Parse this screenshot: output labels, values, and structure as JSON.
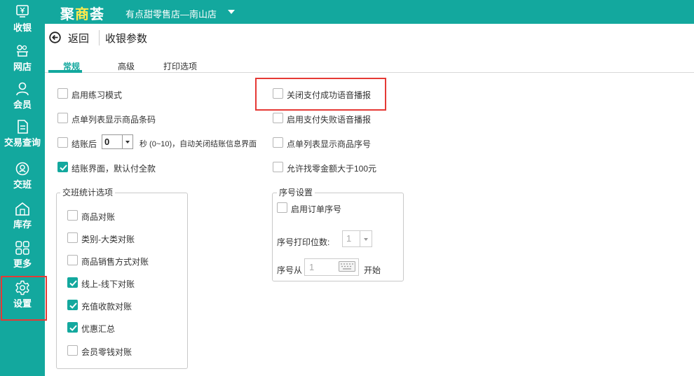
{
  "app": {
    "brand_part1": "聚",
    "brand_part2": "商",
    "brand_part3": "荟",
    "store_name": "有点甜零售店—南山店",
    "accent_color": "#13a89e",
    "highlight_color": "#e53935"
  },
  "sidebar": {
    "items": [
      {
        "label": "收银",
        "icon": "cashier-icon"
      },
      {
        "label": "网店",
        "icon": "online-store-icon"
      },
      {
        "label": "会员",
        "icon": "member-icon"
      },
      {
        "label": "交易查询",
        "icon": "transaction-query-icon"
      },
      {
        "label": "交班",
        "icon": "shift-handover-icon"
      },
      {
        "label": "库存",
        "icon": "inventory-icon"
      },
      {
        "label": "更多",
        "icon": "more-icon"
      },
      {
        "label": "设置",
        "icon": "gear-icon"
      }
    ]
  },
  "header": {
    "back_label": "返回",
    "title": "收银参数"
  },
  "tabs": [
    {
      "label": "常规",
      "active": true
    },
    {
      "label": "高级",
      "active": false
    },
    {
      "label": "打印选项",
      "active": false
    }
  ],
  "general": {
    "practice_mode": {
      "label": "启用练习模式",
      "checked": false
    },
    "show_barcode": {
      "label": "点单列表显示商品条码",
      "checked": false
    },
    "close_after": {
      "label": "结账后",
      "checked": false,
      "value": "0",
      "suffix": "秒 (0~10)，自动关闭结账信息界面"
    },
    "default_full_pay": {
      "label": "结账界面，默认付全款",
      "checked": true
    },
    "close_pay_success_voice": {
      "label": "关闭支付成功语音播报",
      "checked": false
    },
    "enable_pay_fail_voice": {
      "label": "启用支付失败语音播报",
      "checked": false
    },
    "show_item_number": {
      "label": "点单列表显示商品序号",
      "checked": false
    },
    "allow_change_over_100": {
      "label": "允许找零金额大于100元",
      "checked": false
    }
  },
  "shift_stats": {
    "legend": "交班统计选项",
    "options": [
      {
        "label": "商品对账",
        "checked": false
      },
      {
        "label": "类别-大类对账",
        "checked": false
      },
      {
        "label": "商品销售方式对账",
        "checked": false
      },
      {
        "label": "线上-线下对账",
        "checked": true
      },
      {
        "label": "充值收款对账",
        "checked": true
      },
      {
        "label": "优惠汇总",
        "checked": true
      },
      {
        "label": "会员零钱对账",
        "checked": false
      }
    ]
  },
  "serial": {
    "legend": "序号设置",
    "enable_order_serial": {
      "label": "启用订单序号",
      "checked": false
    },
    "digits_label": "序号打印位数:",
    "digits_value": "1",
    "start_label": "序号从",
    "start_value": "1",
    "start_suffix": "开始"
  }
}
